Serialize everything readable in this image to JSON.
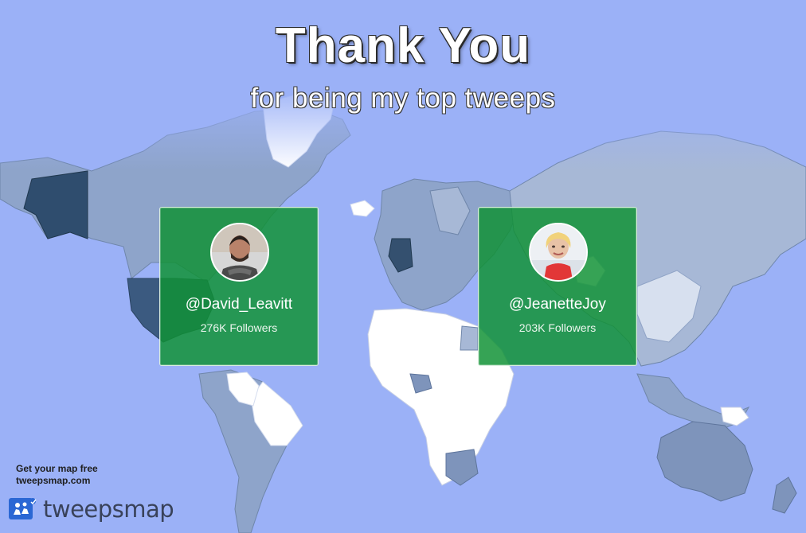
{
  "header": {
    "title": "Thank You",
    "subtitle": "for being my top tweeps"
  },
  "tweeps": [
    {
      "handle": "@David_Leavitt",
      "followers": "276K Followers"
    },
    {
      "handle": "@JeanetteJoy",
      "followers": "203K Followers"
    }
  ],
  "promo": {
    "line1": "Get your map free",
    "line2": "tweepsmap.com"
  },
  "brand": {
    "name": "tweepsmap"
  },
  "colors": {
    "ocean": "#9bb1f7",
    "land_light": "#ffffff",
    "land_medium": "#8fa3c6",
    "land_dark": "#34506f",
    "card_green": "#109134",
    "brand_blue": "#2b67d4"
  },
  "icons": {
    "brand": "tweepsmap-logo-icon",
    "map": "world-map-illustration"
  }
}
